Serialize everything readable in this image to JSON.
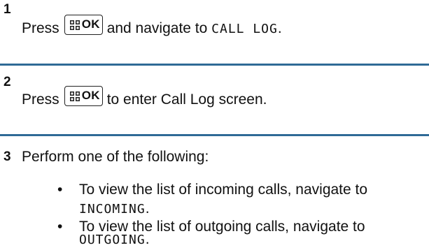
{
  "steps": [
    {
      "number": "1",
      "prefix": "Press",
      "key_label": "OK",
      "key_icon": "menu-grid-icon",
      "suffix": "and navigate to",
      "menu_item": "CALL LOG",
      "end": "."
    },
    {
      "number": "2",
      "prefix": "Press",
      "key_label": "OK",
      "key_icon": "menu-grid-icon",
      "suffix": "to enter Call Log screen."
    },
    {
      "number": "3",
      "text": "Perform one of the following:",
      "bullets": [
        {
          "marker": "•",
          "text": "To view the list of incoming calls, navigate to",
          "menu_item": "INCOMING",
          "end": "."
        },
        {
          "marker": "•",
          "text": "To view the list of outgoing calls, navigate to",
          "menu_item": "OUTGOING",
          "end": "."
        }
      ]
    }
  ],
  "colors": {
    "divider": "#2f6a96",
    "text": "#111111"
  }
}
